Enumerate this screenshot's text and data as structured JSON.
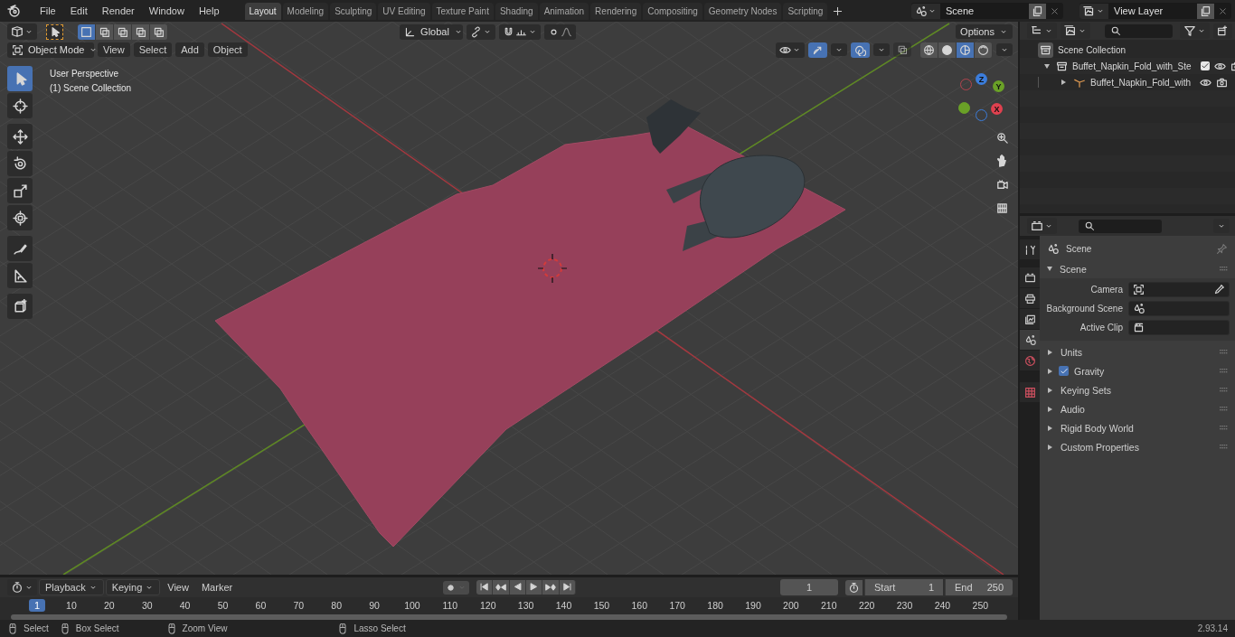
{
  "menu": [
    "File",
    "Edit",
    "Render",
    "Window",
    "Help"
  ],
  "workspaces": [
    {
      "label": "Layout",
      "selected": true
    },
    {
      "label": "Modeling",
      "selected": false
    },
    {
      "label": "Sculpting",
      "selected": false
    },
    {
      "label": "UV Editing",
      "selected": false
    },
    {
      "label": "Texture Paint",
      "selected": false
    },
    {
      "label": "Shading",
      "selected": false
    },
    {
      "label": "Animation",
      "selected": false
    },
    {
      "label": "Rendering",
      "selected": false
    },
    {
      "label": "Compositing",
      "selected": false
    },
    {
      "label": "Geometry Nodes",
      "selected": false
    },
    {
      "label": "Scripting",
      "selected": false
    }
  ],
  "scene": {
    "value": "Scene"
  },
  "view_layer": {
    "value": "View Layer"
  },
  "viewport": {
    "orientation": "Global",
    "options_label": "Options",
    "mode": "Object Mode",
    "menus": [
      "View",
      "Select",
      "Add",
      "Object"
    ],
    "select_modes": [
      {
        "selected": true
      },
      {
        "selected": false
      },
      {
        "selected": false
      },
      {
        "selected": false
      },
      {
        "selected": false
      }
    ],
    "tools": [
      {
        "selected": true
      },
      {
        "selected": false
      },
      {
        "selected": false
      },
      {
        "selected": false
      },
      {
        "selected": false
      },
      {
        "selected": false
      },
      {
        "selected": false
      },
      {
        "selected": false
      },
      {
        "selected": false
      }
    ],
    "overlay_text": [
      "User Perspective",
      "(1) Scene Collection"
    ],
    "snap": {
      "on": false
    },
    "proportional": {
      "on": false
    },
    "gizmos": {
      "on": true
    },
    "overlays": {
      "on": true
    },
    "xray": {
      "on": false
    },
    "shading": [
      {
        "selected": false
      },
      {
        "selected": false
      },
      {
        "selected": true
      },
      {
        "selected": false
      }
    ],
    "axes": [
      "Z",
      "Y",
      "X"
    ]
  },
  "outliner": {
    "root": "Scene Collection",
    "items": [
      {
        "label": "Buffet_Napkin_Fold_with_Ste",
        "expanded": true,
        "checked": true,
        "children": [
          {
            "label": "Buffet_Napkin_Fold_with",
            "expanded": false
          }
        ]
      }
    ]
  },
  "properties": {
    "tabs": [
      {
        "selected": false
      },
      {
        "selected": false
      },
      {
        "selected": false
      },
      {
        "selected": false
      },
      {
        "selected": true
      },
      {
        "selected": false
      },
      {
        "selected": false
      }
    ],
    "context": "Scene",
    "panels": [
      {
        "kind": "fields",
        "title": "Scene",
        "expanded": true,
        "fields": [
          {
            "label": "Camera"
          },
          {
            "label": "Background Scene"
          },
          {
            "label": "Active Clip"
          }
        ]
      },
      {
        "kind": "plain",
        "title": "Units",
        "expanded": false
      },
      {
        "kind": "checkbox",
        "title": "Gravity",
        "expanded": false,
        "checked": true
      },
      {
        "kind": "plain",
        "title": "Keying Sets",
        "expanded": false
      },
      {
        "kind": "plain",
        "title": "Audio",
        "expanded": false
      },
      {
        "kind": "plain",
        "title": "Rigid Body World",
        "expanded": false
      },
      {
        "kind": "plain",
        "title": "Custom Properties",
        "expanded": false
      }
    ]
  },
  "timeline": {
    "menus": [
      "Playback",
      "Keying",
      "View",
      "Marker"
    ],
    "current_frame": "1",
    "start_label": "Start",
    "start": "1",
    "end_label": "End",
    "end": "250",
    "playhead": "1",
    "ruler": [
      "10",
      "20",
      "30",
      "40",
      "50",
      "60",
      "70",
      "80",
      "90",
      "100",
      "110",
      "120",
      "130",
      "140",
      "150",
      "160",
      "170",
      "180",
      "190",
      "200",
      "210",
      "220",
      "230",
      "240",
      "250"
    ]
  },
  "status_bar": {
    "hints": [
      "Select",
      "Box Select",
      "Zoom View",
      "Lasso Select"
    ],
    "version": "2.93.14"
  }
}
